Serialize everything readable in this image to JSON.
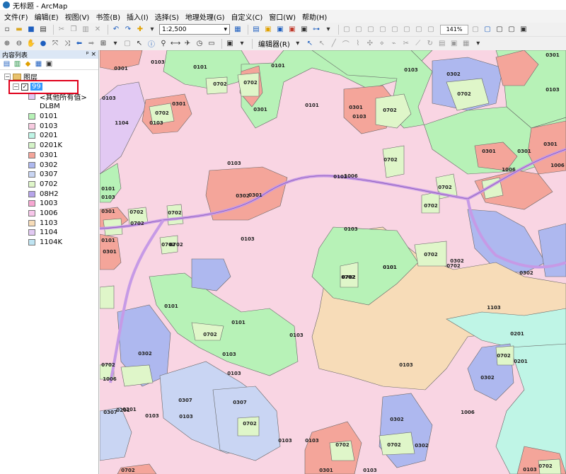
{
  "window": {
    "title": "无标题 - ArcMap"
  },
  "menu": [
    "文件(F)",
    "编辑(E)",
    "视图(V)",
    "书签(B)",
    "插入(I)",
    "选择(S)",
    "地理处理(G)",
    "自定义(C)",
    "窗口(W)",
    "帮助(H)"
  ],
  "toolbar": {
    "scale_value": "1:2,500",
    "zoom_value": "141%",
    "editor_label": "编辑器(R)"
  },
  "toc": {
    "title": "内容列表",
    "pin": "ᵖ",
    "close": "×",
    "root_label": "图层",
    "layer_name": "99",
    "checked": "✓",
    "expander_minus": "−",
    "other_values": "<其他所有值>",
    "field_name": "DLBM",
    "classes": [
      {
        "code": "0101",
        "color": "#b7f2b7"
      },
      {
        "code": "0103",
        "color": "#f7cbe0"
      },
      {
        "code": "0201",
        "color": "#bff5e6"
      },
      {
        "code": "0201K",
        "color": "#d4f3c7"
      },
      {
        "code": "0301",
        "color": "#f4a59a"
      },
      {
        "code": "0302",
        "color": "#aeb8ef"
      },
      {
        "code": "0307",
        "color": "#c9d5f3"
      },
      {
        "code": "0702",
        "color": "#dff6c9"
      },
      {
        "code": "08H2",
        "color": "#b6a4ea"
      },
      {
        "code": "1003",
        "color": "#f7a7d2"
      },
      {
        "code": "1006",
        "color": "#f7c6ea"
      },
      {
        "code": "1103",
        "color": "#f7dcb8"
      },
      {
        "code": "1104",
        "color": "#e2c9f3"
      },
      {
        "code": "1104K",
        "color": "#bfe4f2"
      }
    ]
  },
  "map": {
    "parcel_labels": [
      {
        "text": "0301"
      },
      {
        "text": "0103"
      },
      {
        "text": "0101"
      },
      {
        "text": "0103"
      },
      {
        "text": "0101"
      },
      {
        "text": "0103"
      },
      {
        "text": "0302"
      },
      {
        "text": "0301"
      },
      {
        "text": "0103"
      },
      {
        "text": "0101"
      },
      {
        "text": "0702"
      },
      {
        "text": "0702"
      },
      {
        "text": "0301"
      },
      {
        "text": "0702"
      },
      {
        "text": "0103"
      },
      {
        "text": "0301"
      },
      {
        "text": "0702"
      },
      {
        "text": "0702"
      },
      {
        "text": "0301"
      },
      {
        "text": "0103"
      },
      {
        "text": "1104"
      },
      {
        "text": "0103"
      },
      {
        "text": "0301"
      },
      {
        "text": "1006"
      },
      {
        "text": "0702"
      },
      {
        "text": "0301"
      },
      {
        "text": "0301"
      },
      {
        "text": "1006"
      },
      {
        "text": "0702"
      },
      {
        "text": "0101"
      },
      {
        "text": "0702"
      },
      {
        "text": "0301"
      },
      {
        "text": "0702"
      },
      {
        "text": "0103"
      },
      {
        "text": "0702"
      },
      {
        "text": "0103"
      },
      {
        "text": "0101"
      },
      {
        "text": "0302"
      },
      {
        "text": "0301"
      },
      {
        "text": "0702"
      },
      {
        "text": "0301"
      },
      {
        "text": "0702"
      },
      {
        "text": "0702"
      },
      {
        "text": "0101"
      },
      {
        "text": "0702"
      },
      {
        "text": "0302"
      },
      {
        "text": "0302"
      },
      {
        "text": "0702"
      },
      {
        "text": "0103"
      },
      {
        "text": "0101"
      },
      {
        "text": "1103"
      },
      {
        "text": "0702"
      },
      {
        "text": "0101"
      },
      {
        "text": "0702"
      },
      {
        "text": "0103"
      },
      {
        "text": "0201"
      },
      {
        "text": "0302"
      },
      {
        "text": "0103"
      },
      {
        "text": "0702"
      },
      {
        "text": "0103"
      },
      {
        "text": "0103"
      },
      {
        "text": "0702"
      },
      {
        "text": "0201"
      },
      {
        "text": "1006"
      },
      {
        "text": "0302"
      },
      {
        "text": "0101"
      },
      {
        "text": "0103"
      },
      {
        "text": "0307"
      },
      {
        "text": "0307"
      },
      {
        "text": "0103"
      },
      {
        "text": "0307"
      },
      {
        "text": "0201"
      },
      {
        "text": "0702"
      },
      {
        "text": "0302"
      },
      {
        "text": "0201"
      },
      {
        "text": "0103"
      },
      {
        "text": "0702"
      },
      {
        "text": "0302"
      },
      {
        "text": "0103"
      },
      {
        "text": "0702"
      },
      {
        "text": "0702"
      },
      {
        "text": "1006"
      },
      {
        "text": "0103"
      },
      {
        "text": "0103"
      },
      {
        "text": "0301"
      },
      {
        "text": "0103"
      },
      {
        "text": "0702"
      },
      {
        "text": "0702"
      }
    ],
    "road_label": "1006"
  }
}
